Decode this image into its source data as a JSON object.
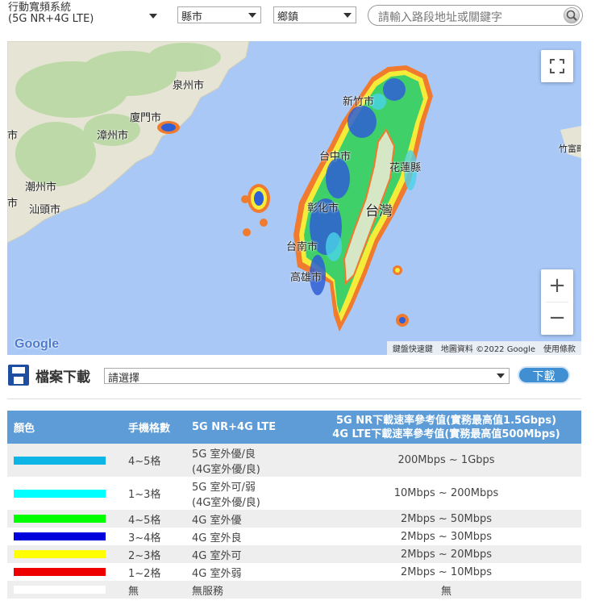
{
  "filters": {
    "system_line1": "行動寬頻系統",
    "system_line2": "(5G NR+4G LTE)",
    "county": "縣市",
    "township": "鄉鎮",
    "search_placeholder": "請輸入路段地址或關鍵字"
  },
  "map": {
    "labels": {
      "quanzhou": "泉州市",
      "xiamen": "廈門市",
      "zhangzhou": "漳州市",
      "chaozhou": "潮州市",
      "shantou": "汕頭市",
      "left_city1": "市",
      "left_city2": "市",
      "hsinchu": "新竹市",
      "taichung": "台中市",
      "hualien": "花蓮縣",
      "taiwan": "台灣",
      "changhua": "彰化市",
      "tainan": "台南市",
      "kaohsiung": "高雄市",
      "taketomi": "竹富町"
    },
    "attribution": {
      "shortcuts": "鍵盤快速鍵",
      "data": "地圖資料 ©2022 Google",
      "terms": "使用條款"
    },
    "logo": "Google",
    "zoom_in": "+",
    "zoom_out": "−"
  },
  "download": {
    "title": "檔案下載",
    "select_placeholder": "請選擇",
    "button": "下載"
  },
  "legend": {
    "headers": {
      "color": "顏色",
      "bars": "手機格數",
      "tech": "5G NR+4G LTE",
      "speed_line1": "5G NR下載速率參考值(實務最高值1.5Gbps)",
      "speed_line2": "4G LTE下載速率參考值(實務最高值500Mbps)"
    },
    "rows": [
      {
        "color": "#0db4e6",
        "bars": "4~5格",
        "tech1": "5G 室外優/良",
        "tech2": "(4G室外優/良)",
        "speed": "200Mbps ~ 1Gbps"
      },
      {
        "color": "#00ffff",
        "bars": "1~3格",
        "tech1": "5G 室外可/弱",
        "tech2": "(4G室外優/良)",
        "speed": "10Mbps ~ 200Mbps"
      },
      {
        "color": "#00ff00",
        "bars": "4~5格",
        "tech1": "4G 室外優",
        "tech2": "",
        "speed": "2Mbps ~ 50Mbps"
      },
      {
        "color": "#0000dd",
        "bars": "3~4格",
        "tech1": "4G 室外良",
        "tech2": "",
        "speed": "2Mbps ~ 30Mbps"
      },
      {
        "color": "#ffff00",
        "bars": "2~3格",
        "tech1": "4G 室外可",
        "tech2": "",
        "speed": "2Mbps ~ 20Mbps"
      },
      {
        "color": "#ee0000",
        "bars": "1~2格",
        "tech1": "4G 室外弱",
        "tech2": "",
        "speed": "2Mbps ~ 10Mbps"
      },
      {
        "color": "#ffffff",
        "bars": "無",
        "tech1": "無服務",
        "tech2": "",
        "speed": "無"
      }
    ]
  }
}
